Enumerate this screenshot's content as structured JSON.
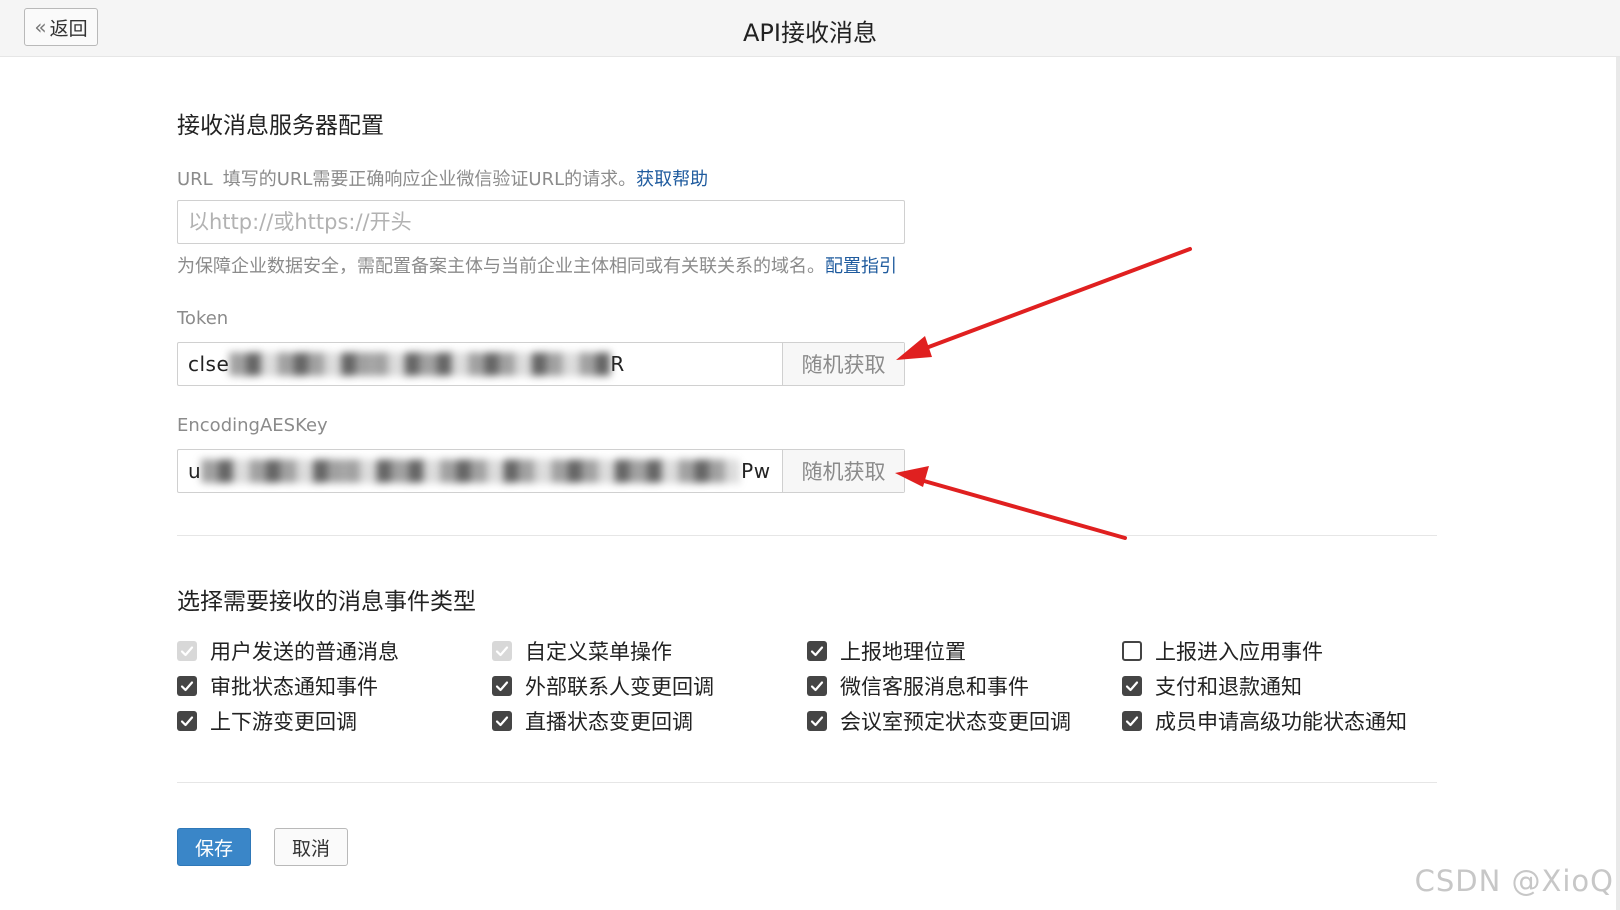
{
  "header": {
    "back_label": "返回",
    "title": "API接收消息"
  },
  "server_config": {
    "title": "接收消息服务器配置",
    "url_label": "URL",
    "url_hint": "填写的URL需要正确响应企业微信验证URL的请求。",
    "url_help_link": "获取帮助",
    "url_placeholder": "以http://或https://开头",
    "domain_note": "为保障企业数据安全，需配置备案主体与当前企业主体相同或有关联关系的域名。",
    "domain_note_link": "配置指引",
    "token_label": "Token",
    "token_value_prefix": "clse",
    "token_value_suffix": "R",
    "token_generate_label": "随机获取",
    "aeskey_label": "EncodingAESKey",
    "aeskey_value_prefix": "u",
    "aeskey_value_suffix": "Pw",
    "aeskey_generate_label": "随机获取"
  },
  "event_types": {
    "title": "选择需要接收的消息事件类型",
    "items": [
      {
        "label": "用户发送的普通消息",
        "state": "disabled"
      },
      {
        "label": "自定义菜单操作",
        "state": "disabled"
      },
      {
        "label": "上报地理位置",
        "state": "checked"
      },
      {
        "label": "上报进入应用事件",
        "state": "unchecked"
      },
      {
        "label": "审批状态通知事件",
        "state": "checked"
      },
      {
        "label": "外部联系人变更回调",
        "state": "checked"
      },
      {
        "label": "微信客服消息和事件",
        "state": "checked"
      },
      {
        "label": "支付和退款通知",
        "state": "checked"
      },
      {
        "label": "上下游变更回调",
        "state": "checked"
      },
      {
        "label": "直播状态变更回调",
        "state": "checked"
      },
      {
        "label": "会议室预定状态变更回调",
        "state": "checked"
      },
      {
        "label": "成员申请高级功能状态通知",
        "state": "checked"
      }
    ]
  },
  "actions": {
    "save_label": "保存",
    "cancel_label": "取消"
  },
  "watermark": "CSDN @XioQ",
  "colors": {
    "primary": "#3a86c8",
    "link": "#1f5b9e",
    "arrow": "#e02020",
    "checkbox_checked": "#454545",
    "checkbox_disabled": "#d8d8d8"
  }
}
